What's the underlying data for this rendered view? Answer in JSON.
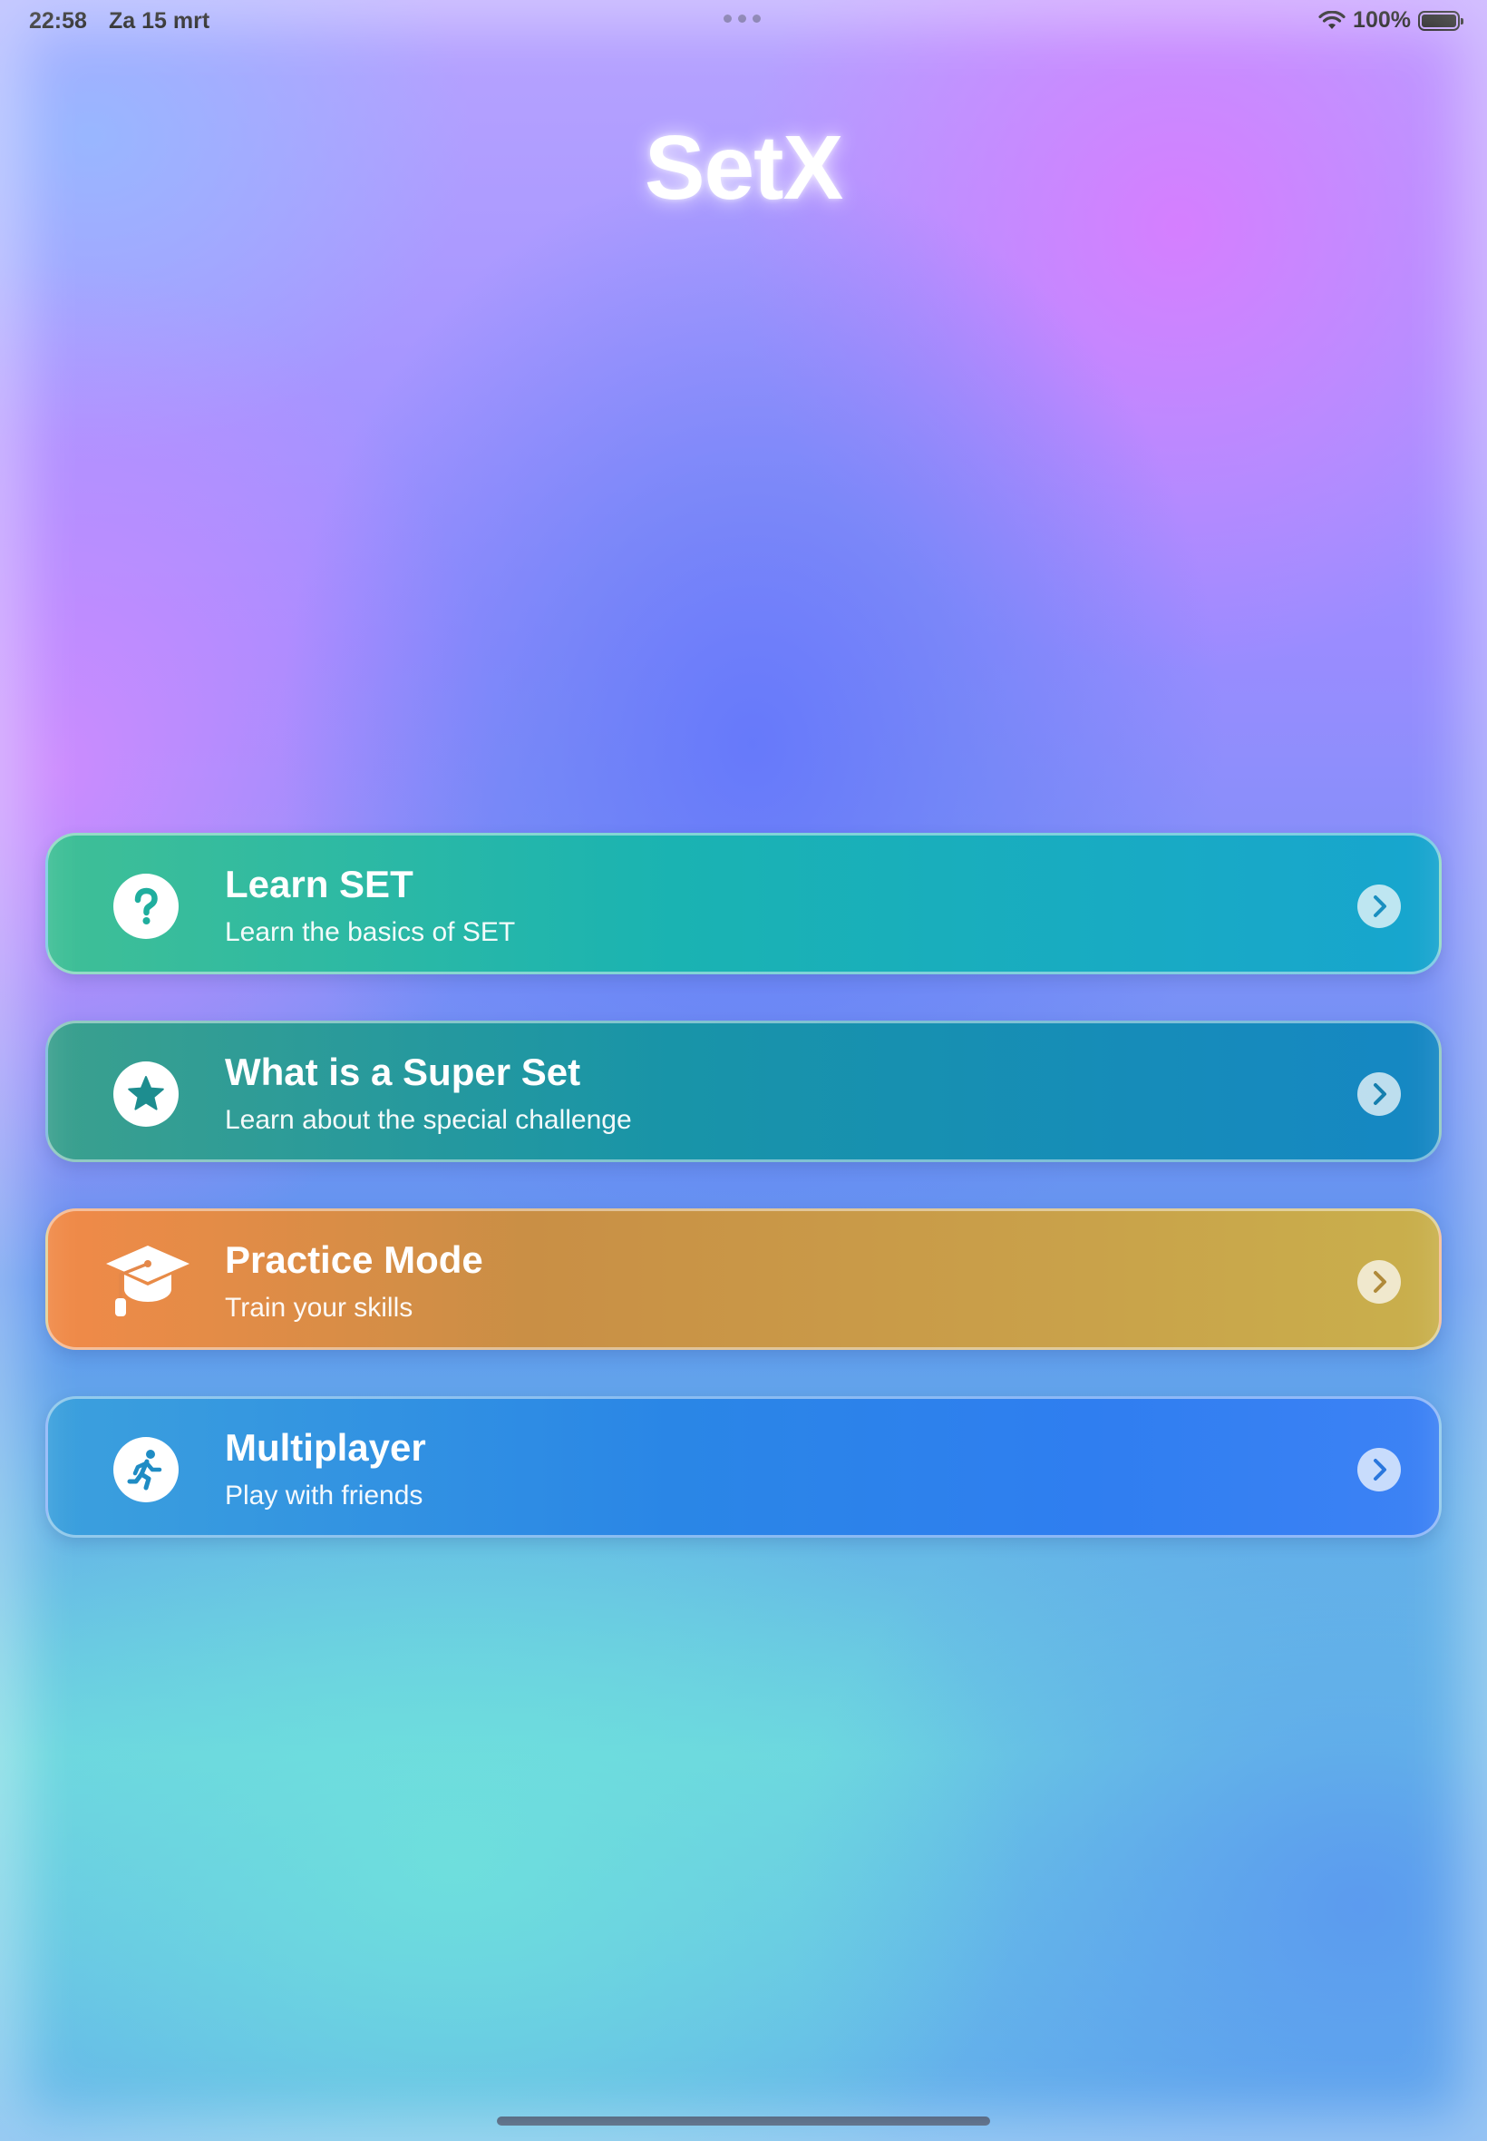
{
  "status_bar": {
    "time": "22:58",
    "date": "Za 15 mrt",
    "battery_text": "100%",
    "icons": [
      "multitasking-dots-icon",
      "wifi-icon",
      "battery-icon"
    ],
    "battery_level": 1.0
  },
  "app": {
    "title": "SetX"
  },
  "menu": {
    "items": [
      {
        "title": "Learn SET",
        "subtitle": "Learn the basics of SET",
        "icon": "question-mark-circle-icon",
        "accent": "#1ab3b2"
      },
      {
        "title": "What is a Super Set",
        "subtitle": "Learn about the special challenge",
        "icon": "star-circle-icon",
        "accent": "#1894a8"
      },
      {
        "title": "Practice Mode",
        "subtitle": "Train your skills",
        "icon": "graduation-cap-icon",
        "accent": "#c98f45"
      },
      {
        "title": "Multiplayer",
        "subtitle": "Play with friends",
        "icon": "running-figure-icon",
        "accent": "#2a86e6"
      }
    ],
    "chevron_icon": "chevron-right-circle-icon"
  }
}
